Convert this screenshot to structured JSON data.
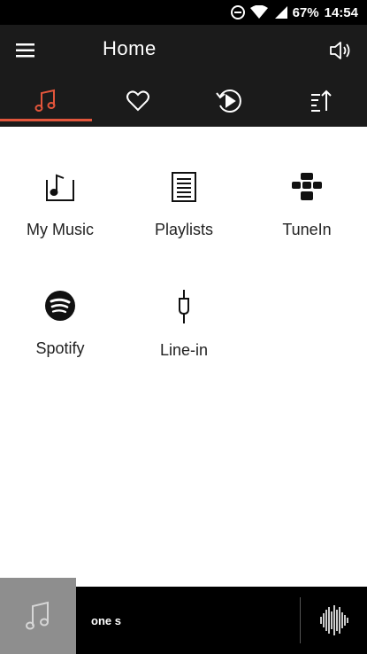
{
  "status_bar": {
    "battery": "67%",
    "time": "14:54",
    "icons": [
      "do-not-disturb-icon",
      "wifi-icon",
      "cellular-signal-icon"
    ]
  },
  "app_bar": {
    "title": "Home",
    "icons": [
      "menu-icon",
      "volume-icon"
    ]
  },
  "tabs": [
    {
      "icon": "music-note-icon",
      "active": true
    },
    {
      "icon": "heart-icon",
      "active": false
    },
    {
      "icon": "recent-play-icon",
      "active": false
    },
    {
      "icon": "sort-icon",
      "active": false
    }
  ],
  "sources": [
    {
      "label": "My Music",
      "icon": "music-folder-icon"
    },
    {
      "label": "Playlists",
      "icon": "playlist-icon"
    },
    {
      "label": "TuneIn",
      "icon": "tunein-icon"
    },
    {
      "label": "Spotify",
      "icon": "spotify-icon"
    },
    {
      "label": "Line-in",
      "icon": "line-in-plug-icon"
    }
  ],
  "player": {
    "track": "one s",
    "icons": [
      "album-art-placeholder-icon",
      "waveform-icon"
    ]
  },
  "colors": {
    "accent": "#e2553b",
    "app_bar": "#1b1b1b",
    "status_bar": "#000000"
  }
}
